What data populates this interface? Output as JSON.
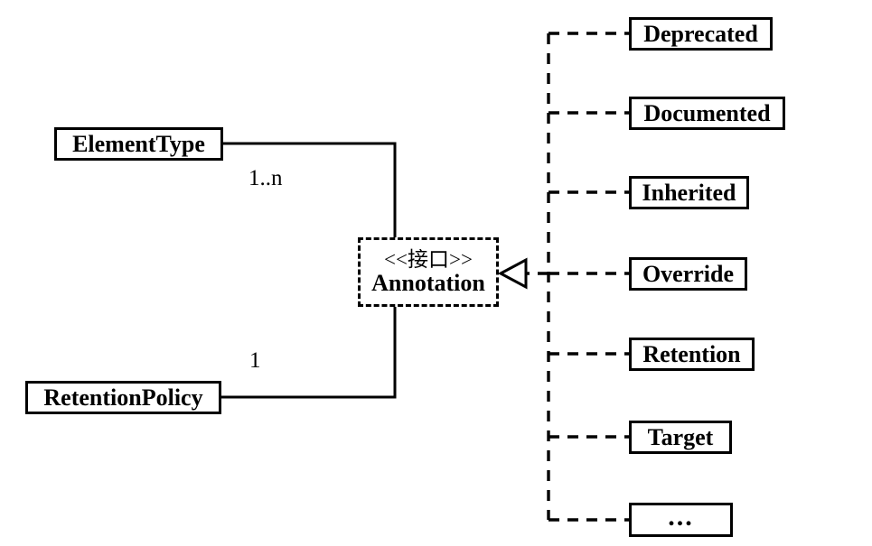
{
  "diagram": {
    "title": "Annotation UML class diagram",
    "type": "uml-class-diagram",
    "background_color": "#ffffff",
    "line_color": "#000000"
  },
  "interface": {
    "stereotype": "<<接口>>",
    "name": "Annotation",
    "border_style": "dashed"
  },
  "associations": [
    {
      "class_name": "ElementType",
      "multiplicity": "1..n"
    },
    {
      "class_name": "RetentionPolicy",
      "multiplicity": "1"
    }
  ],
  "implementations": [
    {
      "name": "Deprecated"
    },
    {
      "name": "Documented"
    },
    {
      "name": "Inherited"
    },
    {
      "name": "Override"
    },
    {
      "name": "Retention"
    },
    {
      "name": "Target"
    },
    {
      "name": "..."
    }
  ]
}
